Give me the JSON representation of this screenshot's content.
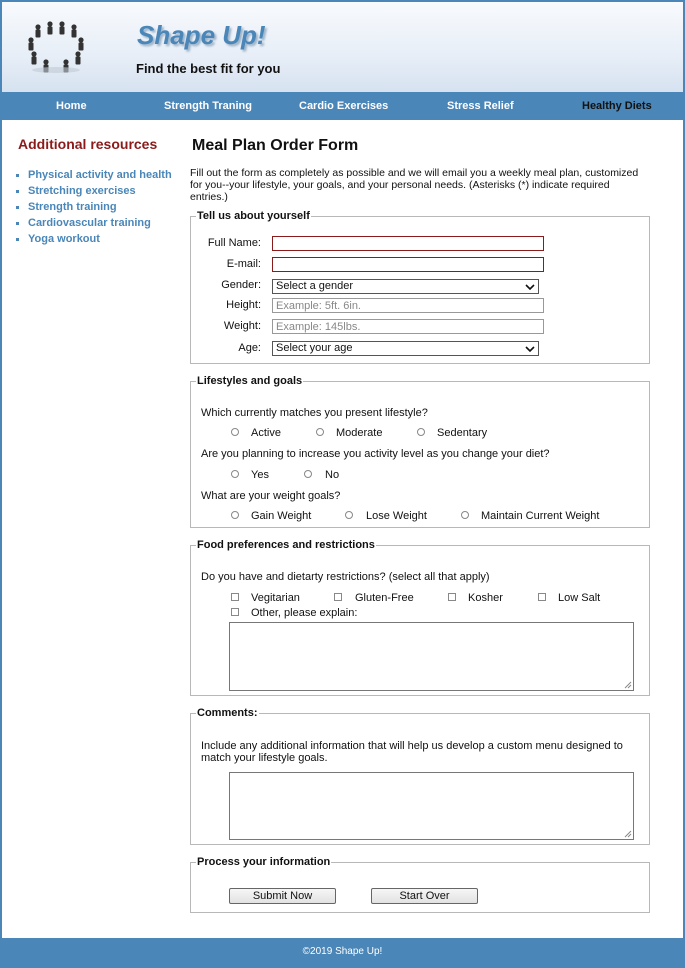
{
  "header": {
    "title": "Shape Up!",
    "tagline": "Find the best fit for you",
    "logo_icon": "people-circle-logo"
  },
  "nav": {
    "items": [
      {
        "label": "Home"
      },
      {
        "label": "Strength Traning"
      },
      {
        "label": "Cardio Exercises"
      },
      {
        "label": "Stress Relief"
      },
      {
        "label": "Healthy Diets"
      }
    ],
    "active": "Healthy Diets"
  },
  "sidebar": {
    "heading": "Additional resources",
    "links": [
      {
        "label": "Physical activity and health"
      },
      {
        "label": "Stretching exercises"
      },
      {
        "label": "Strength training"
      },
      {
        "label": "Cardiovascular training"
      },
      {
        "label": "Yoga workout"
      }
    ]
  },
  "main": {
    "title": "Meal Plan Order Form",
    "intro": "Fill out the form as completely as possible and we will email you a weekly meal plan, customized for you--your lifestyle, your goals, and your personal needs. (Asterisks (*) indicate required entries.)"
  },
  "about": {
    "legend": "Tell us about yourself",
    "full_name_label": "Full Name:",
    "full_name_value": "",
    "email_label": "E-mail:",
    "email_value": "",
    "gender_label": "Gender:",
    "gender_selected": "Select a gender",
    "height_label": "Height:",
    "height_placeholder": "Example: 5ft. 6in.",
    "weight_label": "Weight:",
    "weight_placeholder": "Example: 145lbs.",
    "age_label": "Age:",
    "age_selected": "Select your age"
  },
  "lifestyle": {
    "legend": "Lifestyles and goals",
    "q1": "Which currently matches you present lifestyle?",
    "q1_options": [
      "Active",
      "Moderate",
      "Sedentary"
    ],
    "q2": "Are you planning to increase you activity level as you change your diet?",
    "q2_options": [
      "Yes",
      "No"
    ],
    "q3": "What are your weight goals?",
    "q3_options": [
      "Gain Weight",
      "Lose Weight",
      "Maintain Current Weight"
    ]
  },
  "food": {
    "legend": "Food preferences and restrictions",
    "question": "Do you have and dietarty restrictions? (select all that apply)",
    "options": [
      "Vegitarian",
      "Gluten-Free",
      "Kosher",
      "Low Salt"
    ],
    "other_label": "Other, please explain:"
  },
  "comments": {
    "legend": "Comments:",
    "text": "Include any additional information that will help us develop a custom menu designed to match your lifestyle goals."
  },
  "process": {
    "legend": "Process your information",
    "submit_label": "Submit Now",
    "reset_label": "Start Over"
  },
  "footer": {
    "text": "©2019 Shape Up!"
  },
  "colors": {
    "accent": "#4a86b8",
    "heading_red": "#8b1a1a"
  }
}
